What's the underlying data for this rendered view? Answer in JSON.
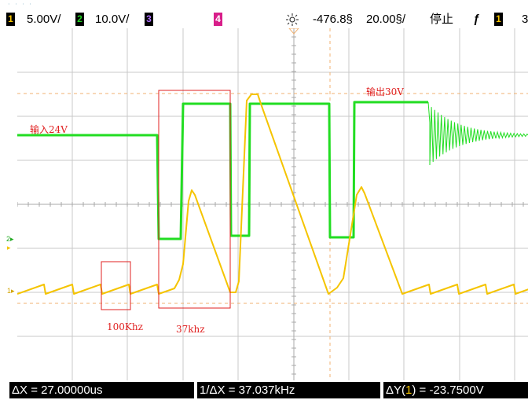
{
  "top_bar": {
    "ch1": {
      "num": "1",
      "scale": "5.00V/",
      "color": "#f5c400"
    },
    "ch2": {
      "num": "2",
      "scale": "10.0V/",
      "color": "#22d422"
    },
    "ch3": {
      "num": "3",
      "color": "#7a28c8"
    },
    "ch4": {
      "num": "4",
      "color": "#d81e8a"
    },
    "trigger_icon": "trigger-sun-icon",
    "trig_position": "-476.8§",
    "time_scale": "20.00§/",
    "run_state": "停止",
    "edge_icon": "rising-edge-icon",
    "trig_ch": "1",
    "right_cut": "3"
  },
  "annotations": {
    "input": "输入24V",
    "output": "输出30V",
    "freq_a": "100Khz",
    "freq_b": "37khz"
  },
  "measurements": {
    "dx": "ΔX = 27.00000us",
    "inv_dx": "1/ΔX = 37.037kHz",
    "dy_prefix": "ΔY(",
    "dy_ch": "1",
    "dy_suffix": ") = -23.7500V"
  },
  "colors": {
    "ch1": "#f5c400",
    "ch2": "#22dd22",
    "grid": "#c9c9c9",
    "cursor": "#f0b070",
    "annot": "#e02020"
  }
}
